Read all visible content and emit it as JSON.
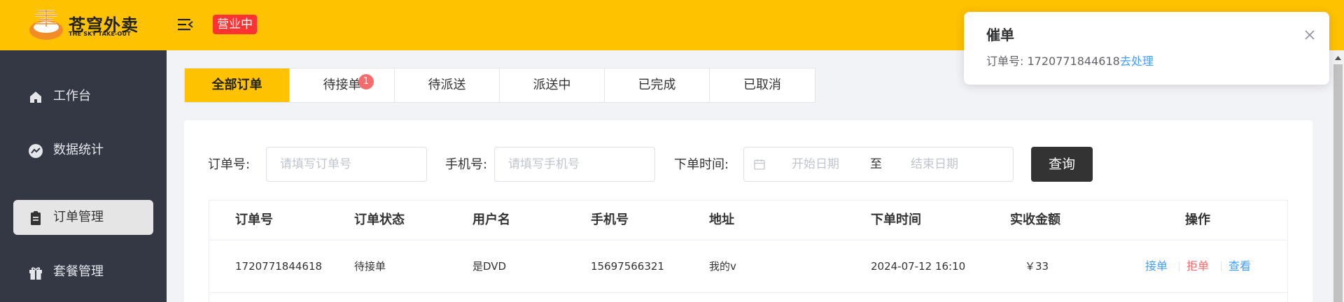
{
  "header": {
    "logo_cn": "苍穹外卖",
    "logo_en": "THE SKY TAKE-OUT",
    "status": "营业中",
    "colors": {
      "bar": "#ffc200",
      "status_badge": "#fd3333"
    }
  },
  "sidebar": {
    "items": [
      {
        "label": "工作台",
        "icon": "home-icon",
        "active": false
      },
      {
        "label": "数据统计",
        "icon": "chart-icon",
        "active": false
      },
      {
        "label": "订单管理",
        "icon": "clipboard-icon",
        "active": true
      },
      {
        "label": "套餐管理",
        "icon": "gift-icon",
        "active": false
      }
    ]
  },
  "tabs": [
    {
      "label": "全部订单",
      "active": true
    },
    {
      "label": "待接单",
      "count": "1"
    },
    {
      "label": "待派送"
    },
    {
      "label": "派送中"
    },
    {
      "label": "已完成"
    },
    {
      "label": "已取消"
    }
  ],
  "filters": {
    "order_no_label": "订单号:",
    "order_no_placeholder": "请填写订单号",
    "phone_label": "手机号:",
    "phone_placeholder": "请填写手机号",
    "time_label": "下单时间:",
    "start_placeholder": "开始日期",
    "range_separator": "至",
    "end_placeholder": "结束日期",
    "query_button": "查询"
  },
  "table": {
    "columns": [
      "订单号",
      "订单状态",
      "用户名",
      "手机号",
      "地址",
      "下单时间",
      "实收金额",
      "操作"
    ],
    "rows": [
      {
        "order_no": "1720771844618",
        "status": "待接单",
        "user": "是DVD",
        "phone": "15697566321",
        "address": "我的v",
        "time": "2024-07-12 16:10",
        "amount": "￥33",
        "actions": [
          "接单",
          "拒单",
          "查看"
        ]
      }
    ]
  },
  "notification": {
    "title": "催单",
    "body_prefix": "订单号: 1720771844618",
    "link": "去处理"
  }
}
